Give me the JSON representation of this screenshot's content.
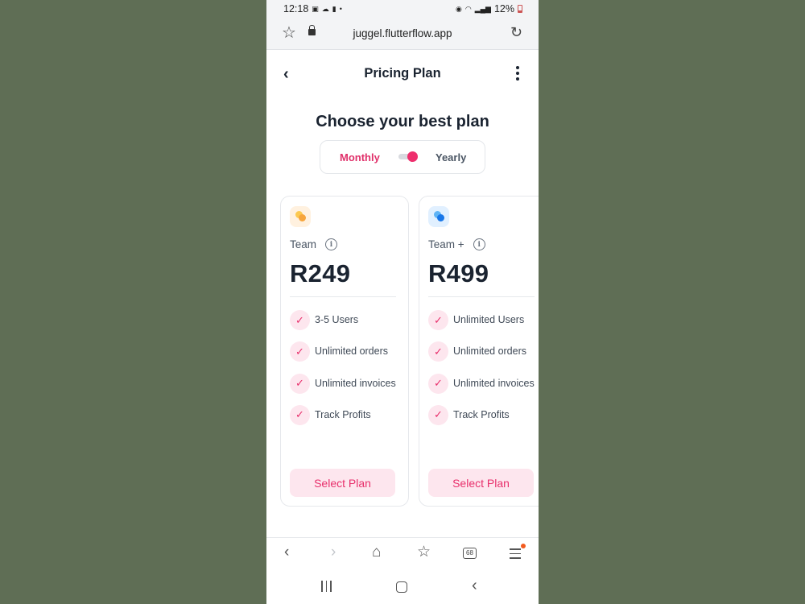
{
  "status_bar": {
    "time": "12:18",
    "battery": "12%",
    "left_icons": [
      "image-icon",
      "cloud-icon",
      "lock-icon"
    ],
    "right_icons": [
      "alarm-icon",
      "wifi-icon",
      "signal-icon"
    ]
  },
  "browser": {
    "url": "juggel.flutterflow.app"
  },
  "appbar": {
    "title": "Pricing Plan"
  },
  "main": {
    "heading": "Choose your best plan",
    "toggle": {
      "monthly_label": "Monthly",
      "yearly_label": "Yearly",
      "active_option": "Monthly"
    }
  },
  "plans": [
    {
      "name": "Team",
      "price": "R249",
      "icon": "orange-dots-icon",
      "features": [
        "3-5 Users",
        "Unlimited orders",
        "Unlimited invoices",
        "Track Profits"
      ],
      "button_label": "Select Plan"
    },
    {
      "name": "Team +",
      "price": "R499",
      "icon": "blue-dots-icon",
      "features": [
        "Unlimited Users",
        "Unlimited orders",
        "Unlimited invoices",
        "Track Profits"
      ],
      "button_label": "Select Plan"
    }
  ],
  "bottom_nav": {
    "tab_count": "68"
  },
  "colors": {
    "accent": "#e8306c",
    "accent_light": "#fde6ee",
    "text_dark": "#1a2330",
    "background": "#5f6e55"
  }
}
